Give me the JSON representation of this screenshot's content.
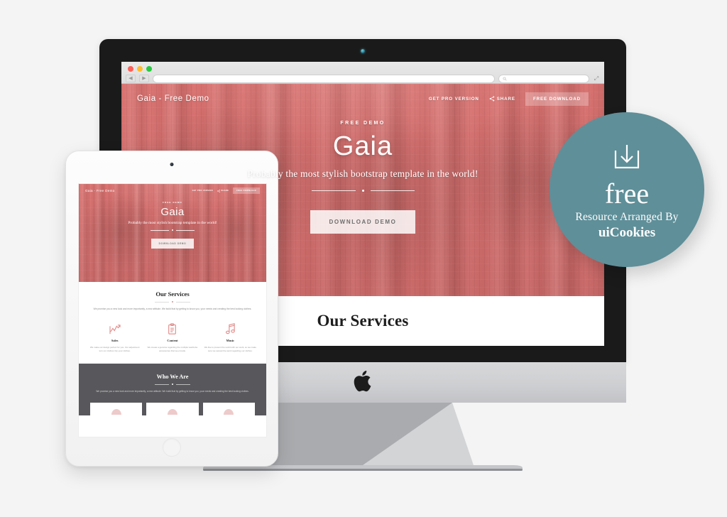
{
  "page": {
    "background_color": "#f4f4f4"
  },
  "browser": {
    "url_value": "",
    "url_placeholder": "",
    "search_placeholder": "",
    "search_icon": "search-icon",
    "back_icon": "◀",
    "forward_icon": "▶",
    "fullscreen_icon": "⤢",
    "traffic_lights": [
      "close-red",
      "minimize-yellow",
      "maximize-green"
    ]
  },
  "site": {
    "brand": "Gaia - Free Demo",
    "nav": {
      "pro_version": "GET PRO VERSION",
      "share": "SHARE",
      "share_icon": "share-icon",
      "free_download": "FREE DOWNLOAD"
    },
    "hero": {
      "eyebrow": "FREE DEMO",
      "title": "Gaia",
      "subtitle": "Probably the most stylish bootstrap template in the world!",
      "cta": "DOWNLOAD DEMO"
    },
    "services": {
      "heading": "Our Services",
      "lead": "We promise you a new look and more importantly, a new attitude. We build that by getting to know you, your needs and creating the best looking clothes.",
      "columns": [
        {
          "icon": "line-chart-icon",
          "title": "Sales",
          "text": "We make our design perfect for you. Our adjustment turn our clothes into your clothes."
        },
        {
          "icon": "clipboard-icon",
          "title": "Content",
          "text": "We create a genuine regarding the multiple wardrobe accessories that we provide."
        },
        {
          "icon": "music-note-icon",
          "title": "Music",
          "text": "We like to present the world with our work, so we make sure we spread the word regarding our clothes."
        }
      ]
    },
    "who_we_are": {
      "heading": "Who We Are",
      "lead": "We promise you a new look and more importantly, a new attitude. We build that by getting to know you, your needs and creating the best looking clothes.",
      "cards": [
        "card-one",
        "card-two",
        "card-three"
      ]
    }
  },
  "badge": {
    "icon": "download-box-icon",
    "free": "free",
    "resource": "Resource Arranged By",
    "brand": "uiCookies",
    "color": "#5f8f99"
  },
  "devices": {
    "desktop": {
      "name": "imac",
      "logo_icon": "apple-logo-icon",
      "webcam_icon": "webcam-icon"
    },
    "tablet": {
      "name": "ipad",
      "camera_icon": "camera-icon",
      "home_button_icon": "home-button-icon"
    }
  }
}
